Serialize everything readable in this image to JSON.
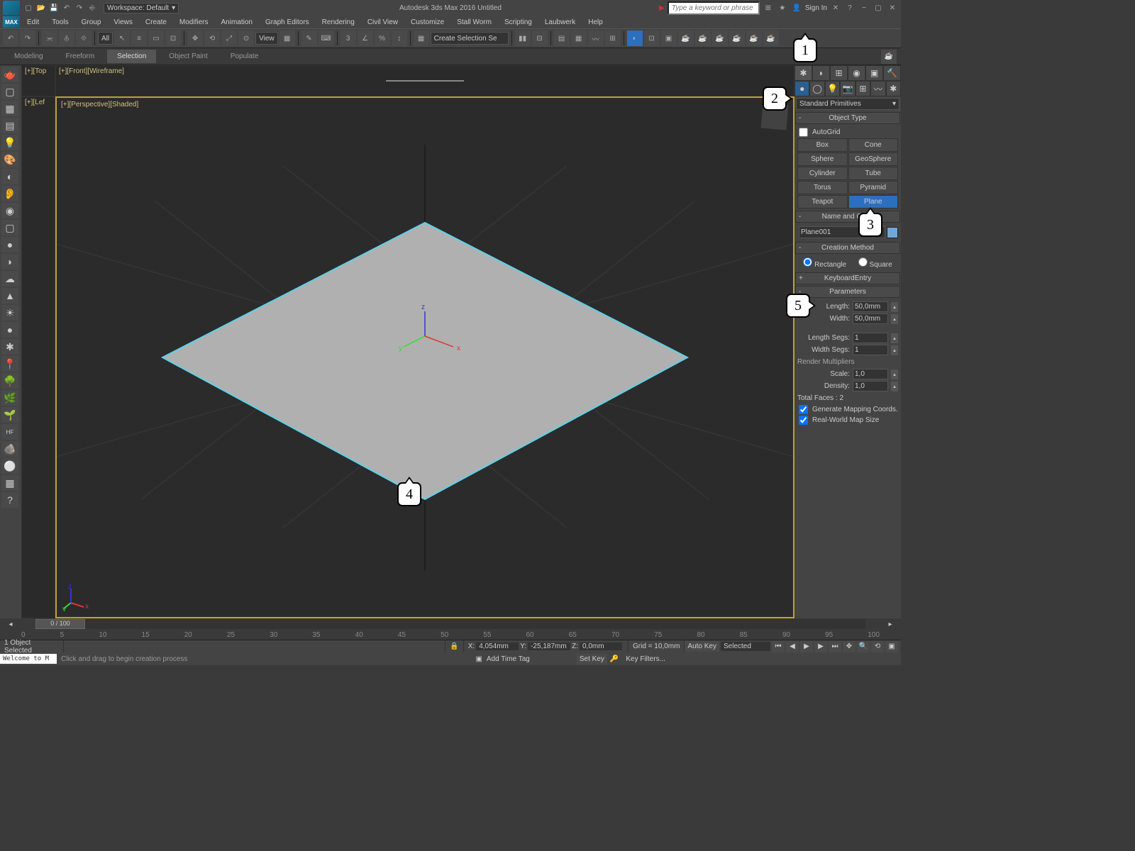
{
  "title_bar": {
    "workspace_label": "Workspace: Default",
    "app_title": "Autodesk 3ds Max 2016    Untitled",
    "search_placeholder": "Type a keyword or phrase",
    "sign_in": "Sign In"
  },
  "menu": [
    "Edit",
    "Tools",
    "Group",
    "Views",
    "Create",
    "Modifiers",
    "Animation",
    "Graph Editors",
    "Rendering",
    "Civil View",
    "Customize",
    "Stall Worm",
    "Scripting",
    "Laubwerk",
    "Help"
  ],
  "menu_logo": "MAX",
  "ribbon": {
    "tabs": [
      "Modeling",
      "Freeform",
      "Selection",
      "Object Paint",
      "Populate"
    ],
    "active_index": 2
  },
  "toolbar": {
    "filter_all": "All",
    "view_label": "View",
    "create_sel_set": "Create Selection Se"
  },
  "viewport": {
    "top_label": "[+][Top",
    "front_label": "[+][Front][Wireframe]",
    "left_label": "[+][Lef",
    "main_label": "[+][Perspective][Shaded]"
  },
  "command_panel": {
    "category": "Standard Primitives",
    "object_type_header": "Object Type",
    "autogrid": "AutoGrid",
    "buttons": [
      [
        "Box",
        "Cone"
      ],
      [
        "Sphere",
        "GeoSphere"
      ],
      [
        "Cylinder",
        "Tube"
      ],
      [
        "Torus",
        "Pyramid"
      ],
      [
        "Teapot",
        "Plane"
      ]
    ],
    "active_button": "Plane",
    "name_header": "Name and Color",
    "object_name": "Plane001",
    "creation_method_header": "Creation Method",
    "creation_methods": [
      "Rectangle",
      "Square"
    ],
    "keyboard_entry_header": "KeyboardEntry",
    "parameters_header": "Parameters",
    "length_label": "Length:",
    "length_value": "50,0mm",
    "width_label": "Width:",
    "width_value": "50,0mm",
    "length_segs_label": "Length Segs:",
    "length_segs_value": "1",
    "width_segs_label": "Width Segs:",
    "width_segs_value": "1",
    "render_mult_header": "Render Multipliers",
    "scale_label": "Scale:",
    "scale_value": "1,0",
    "density_label": "Density:",
    "density_value": "1,0",
    "total_faces": "Total Faces : 2",
    "gen_mapping": "Generate Mapping Coords.",
    "real_world": "Real-World Map Size"
  },
  "timeline": {
    "slider_label": "0 / 100",
    "ticks": [
      "0",
      "5",
      "10",
      "15",
      "20",
      "25",
      "30",
      "35",
      "40",
      "45",
      "50",
      "55",
      "60",
      "65",
      "70",
      "75",
      "80",
      "85",
      "90",
      "95",
      "100"
    ]
  },
  "status": {
    "selected": "1 Object Selected",
    "x_label": "X:",
    "x_value": "4,054mm",
    "y_label": "Y:",
    "y_value": "-25,187mm",
    "z_label": "Z:",
    "z_value": "0,0mm",
    "grid": "Grid = 10,0mm",
    "add_time_tag": "Add Time Tag",
    "auto_key": "Auto Key",
    "set_key": "Set Key",
    "selected_dd": "Selected",
    "key_filters": "Key Filters...",
    "maxscript": "Welcome to M",
    "prompt": "Click and drag to begin creation process"
  },
  "callouts": {
    "c1": "1",
    "c2": "2",
    "c3": "3",
    "c4": "4",
    "c5": "5"
  }
}
